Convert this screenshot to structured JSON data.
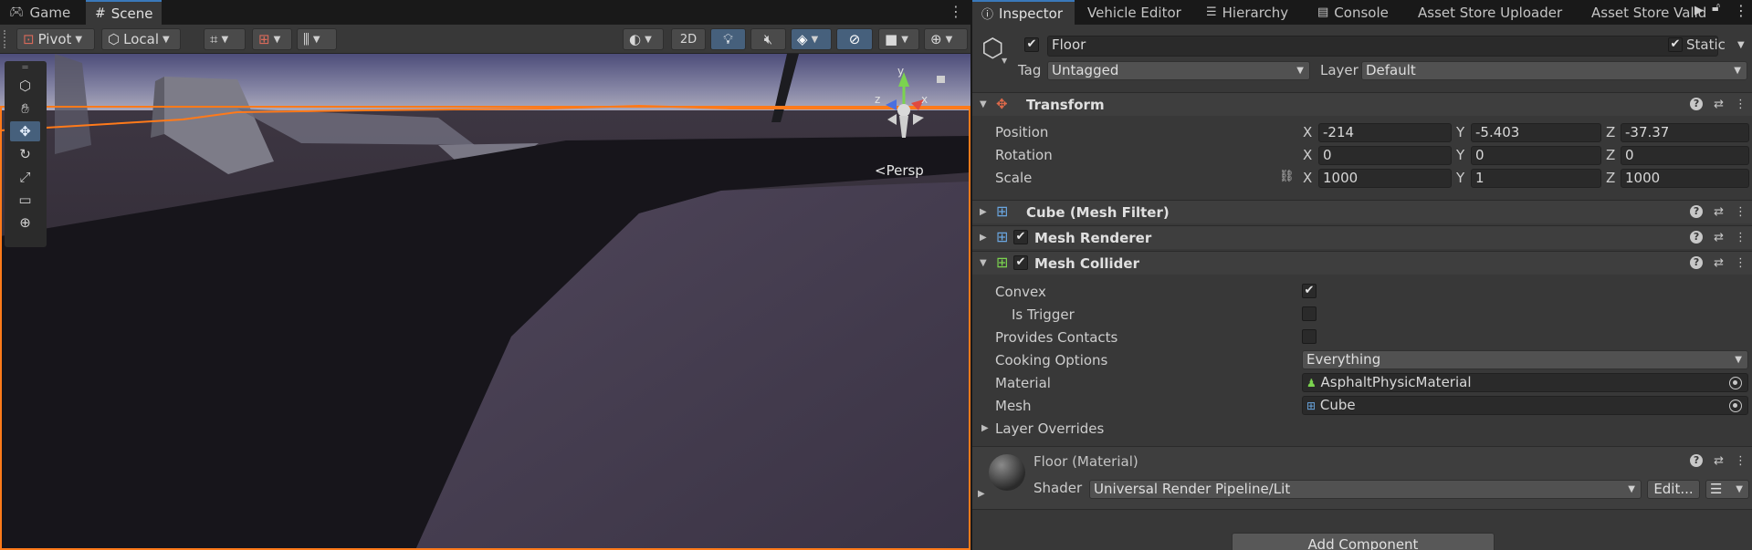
{
  "left_tabs": [
    {
      "label": "Game",
      "icon": "gamepad-icon"
    },
    {
      "label": "Scene",
      "icon": "grid-icon"
    }
  ],
  "scene_toolbar": {
    "pivot": "Pivot",
    "local": "Local",
    "mode_2d": "2D"
  },
  "scene": {
    "persp_label": "Persp",
    "gizmo_y": "y",
    "gizmo_x": "x",
    "gizmo_z": "z"
  },
  "right_tabs": [
    "Inspector",
    "Vehicle Editor",
    "Hierarchy",
    "Console",
    "Asset Store Uploader",
    "Asset Store Valid"
  ],
  "object": {
    "name": "Floor",
    "active": true,
    "static_label": "Static",
    "static": true,
    "tag_label": "Tag",
    "tag": "Untagged",
    "layer_label": "Layer",
    "layer": "Default"
  },
  "transform": {
    "title": "Transform",
    "position_label": "Position",
    "rotation_label": "Rotation",
    "scale_label": "Scale",
    "position": {
      "x": "-214",
      "y": "-5.403",
      "z": "-37.37"
    },
    "rotation": {
      "x": "0",
      "y": "0",
      "z": "0"
    },
    "scale": {
      "x": "1000",
      "y": "1",
      "z": "1000"
    },
    "axis_x": "X",
    "axis_y": "Y",
    "axis_z": "Z"
  },
  "mesh_filter": {
    "title": "Cube (Mesh Filter)"
  },
  "mesh_renderer": {
    "title": "Mesh Renderer",
    "enabled": true
  },
  "mesh_collider": {
    "title": "Mesh Collider",
    "enabled": true,
    "convex_label": "Convex",
    "convex": true,
    "is_trigger_label": "Is Trigger",
    "is_trigger": false,
    "provides_contacts_label": "Provides Contacts",
    "provides_contacts": false,
    "cooking_options_label": "Cooking Options",
    "cooking_options": "Everything",
    "material_label": "Material",
    "material": "AsphaltPhysicMaterial",
    "mesh_label": "Mesh",
    "mesh": "Cube",
    "layer_overrides_label": "Layer Overrides"
  },
  "material": {
    "title": "Floor (Material)",
    "shader_label": "Shader",
    "shader": "Universal Render Pipeline/Lit",
    "edit_label": "Edit..."
  },
  "add_component_label": "Add Component",
  "colors": {
    "selection_outline": "#ff7a1a",
    "active_tab_accent": "#3a79bb",
    "toolbar_bg": "#383838"
  }
}
